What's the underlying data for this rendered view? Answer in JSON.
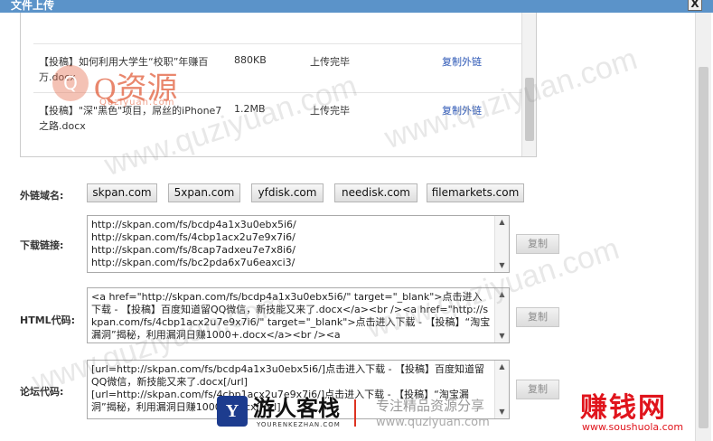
{
  "dialog": {
    "title": "文件上传",
    "close_glyph": "X"
  },
  "files": [
    {
      "name": "【投稿】如何利用大学生“校职”年赚百万.docx",
      "size": "880KB",
      "status": "上传完毕",
      "action": "复制外链"
    },
    {
      "name": "【投稿】\"深\"黑色\"项目，屌丝的iPhone7之路.docx",
      "size": "1.2MB",
      "status": "上传完毕",
      "action": "复制外链"
    }
  ],
  "domains": {
    "label": "外链域名:",
    "options": [
      "skpan.com",
      "5xpan.com",
      "yfdisk.com",
      "needisk.com",
      "filemarkets.com"
    ]
  },
  "download": {
    "label": "下载链接:",
    "text": "http://skpan.com/fs/bcdp4a1x3u0ebx5i6/\nhttp://skpan.com/fs/4cbp1acx2u7e9x7i6/\nhttp://skpan.com/fs/8cap7adxeu7e7x8i6/\nhttp://skpan.com/fs/bc2pda6x7u6eaxci3/",
    "copy_label": "复制"
  },
  "html_code": {
    "label": "HTML代码:",
    "text": "<a href=\"http://skpan.com/fs/bcdp4a1x3u0ebx5i6/\" target=\"_blank\">点击进入下载 - 【投稿】百度知道留QQ微信，新技能又来了.docx</a><br /><a href=\"http://skpan.com/fs/4cbp1acx2u7e9x7i6/\" target=\"_blank\">点击进入下载 - 【投稿】“淘宝漏洞”揭秘，利用漏洞日赚1000+.docx</a><br /><a",
    "copy_label": "复制"
  },
  "forum_code": {
    "label": "论坛代码:",
    "text": "[url=http://skpan.com/fs/bcdp4a1x3u0ebx5i6/]点击进入下载 - 【投稿】百度知道留QQ微信，新技能又来了.docx[/url]\n[url=http://skpan.com/fs/4cbp1acx2u7e9x7i6/]点击进入下载 - 【投稿】“淘宝漏洞”揭秘，利用漏洞日赚1000+.docx[/url]",
    "copy_label": "复制"
  },
  "watermark": {
    "text": "www.quziyuan.com",
    "logo_name": "Q资源",
    "logo_url": "Quziyuan.com"
  },
  "footer_logo": {
    "mark": "Y",
    "name": "游人客栈",
    "domain": "YOURENKEZHAN.COM",
    "slogan": "专注精品资源分享",
    "url": "www.quziyuan.com"
  },
  "corner_logo": {
    "name": "赚钱网",
    "url": "www.soushuola.com"
  }
}
